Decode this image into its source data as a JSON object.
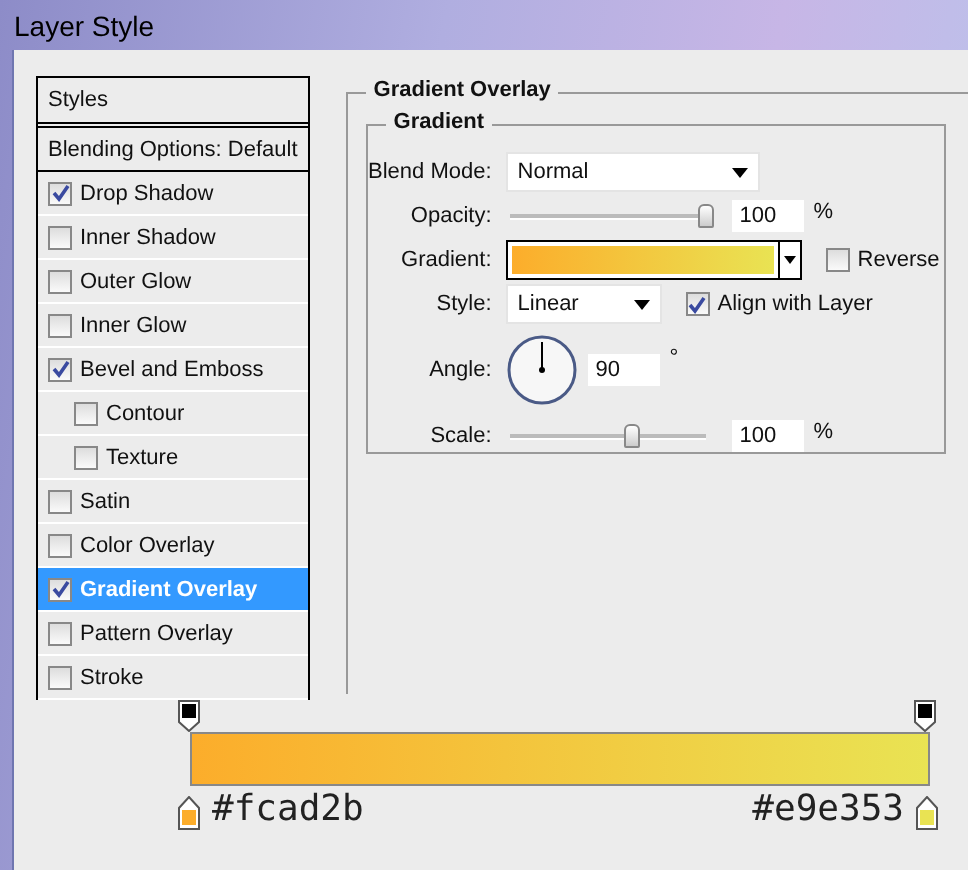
{
  "window": {
    "title": "Layer Style"
  },
  "styles_list": {
    "header": "Styles",
    "blending_options": "Blending Options: Default",
    "items": [
      {
        "label": "Drop Shadow",
        "checked": true,
        "selected": false
      },
      {
        "label": "Inner Shadow",
        "checked": false,
        "selected": false
      },
      {
        "label": "Outer Glow",
        "checked": false,
        "selected": false
      },
      {
        "label": "Inner Glow",
        "checked": false,
        "selected": false
      },
      {
        "label": "Bevel and Emboss",
        "checked": true,
        "selected": false,
        "children": [
          {
            "label": "Contour",
            "checked": false,
            "selected": false
          },
          {
            "label": "Texture",
            "checked": false,
            "selected": false
          }
        ]
      },
      {
        "label": "Satin",
        "checked": false,
        "selected": false
      },
      {
        "label": "Color Overlay",
        "checked": false,
        "selected": false
      },
      {
        "label": "Gradient Overlay",
        "checked": true,
        "selected": true
      },
      {
        "label": "Pattern Overlay",
        "checked": false,
        "selected": false
      },
      {
        "label": "Stroke",
        "checked": false,
        "selected": false
      }
    ]
  },
  "panel": {
    "title": "Gradient Overlay",
    "group": "Gradient",
    "blend_mode": {
      "label": "Blend Mode:",
      "value": "Normal"
    },
    "opacity": {
      "label": "Opacity:",
      "level": 1,
      "value": "100",
      "unit": "%"
    },
    "gradient": {
      "label": "Gradient:",
      "reverse": {
        "label": "Reverse",
        "checked": false
      }
    },
    "style": {
      "label": "Style:",
      "value": "Linear",
      "align": {
        "label": "Align with Layer",
        "checked": true
      }
    },
    "angle": {
      "label": "Angle:",
      "value": "90",
      "unit": "°"
    },
    "scale": {
      "label": "Scale:",
      "level": 0.62,
      "value": "100",
      "unit": "%"
    }
  },
  "gradient_editor": {
    "stops": [
      {
        "color": "#fcad2b",
        "label": "#fcad2b"
      },
      {
        "color": "#e9e353",
        "label": "#e9e353"
      }
    ]
  }
}
